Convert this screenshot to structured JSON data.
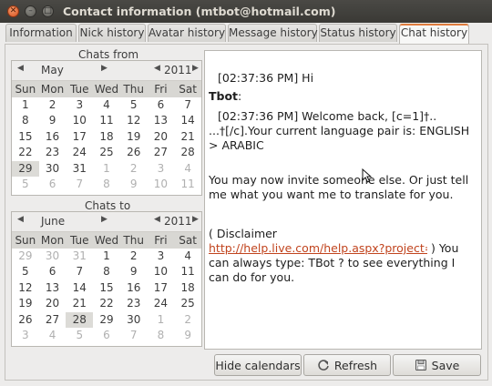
{
  "window": {
    "title": "Contact information (mtbot@hotmail.com)"
  },
  "tabs": [
    "Information",
    "Nick history",
    "Avatar history",
    "Message history",
    "Status history",
    "Chat history"
  ],
  "active_tab": "Chat history",
  "calendars": {
    "from": {
      "label": "Chats from",
      "month": "May",
      "year": "2011",
      "dow": [
        "Sun",
        "Mon",
        "Tue",
        "Wed",
        "Thu",
        "Fri",
        "Sat"
      ],
      "days": [
        [
          "1",
          "2",
          "3",
          "4",
          "5",
          "6",
          "7"
        ],
        [
          "8",
          "9",
          "10",
          "11",
          "12",
          "13",
          "14"
        ],
        [
          "15",
          "16",
          "17",
          "18",
          "19",
          "20",
          "21"
        ],
        [
          "22",
          "23",
          "24",
          "25",
          "26",
          "27",
          "28"
        ],
        [
          "29",
          "30",
          "31",
          "1",
          "2",
          "3",
          "4"
        ],
        [
          "5",
          "6",
          "7",
          "8",
          "9",
          "10",
          "11"
        ]
      ],
      "selected": "29"
    },
    "to": {
      "label": "Chats to",
      "month": "June",
      "year": "2011",
      "dow": [
        "Sun",
        "Mon",
        "Tue",
        "Wed",
        "Thu",
        "Fri",
        "Sat"
      ],
      "days": [
        [
          "29",
          "30",
          "31",
          "1",
          "2",
          "3",
          "4"
        ],
        [
          "5",
          "6",
          "7",
          "8",
          "9",
          "10",
          "11"
        ],
        [
          "12",
          "13",
          "14",
          "15",
          "16",
          "17",
          "18"
        ],
        [
          "19",
          "20",
          "21",
          "22",
          "23",
          "24",
          "25"
        ],
        [
          "26",
          "27",
          "28",
          "29",
          "30",
          "1",
          "2"
        ],
        [
          "3",
          "4",
          "5",
          "6",
          "7",
          "8",
          "9"
        ]
      ],
      "selected": "28"
    }
  },
  "chat": {
    "line1": "[02:37:36 PM] Hi",
    "sender": "Tbot",
    "sender_suffix": ":",
    "line2": "[02:37:36 PM] Welcome back, [c=1]†..          ...†[/c].Your current language pair is: ENGLISH > ARABIC",
    "line3": "You may now invite someone else. Or just tell me what you want me to translate for you.",
    "line4": "( Disclaimer",
    "link": "http://help.live.com/help.aspx?project=tou",
    "line5": ") You can always type: TBot ? to see everything I can do for you."
  },
  "buttons": {
    "hide": "Hide calendars",
    "refresh": "Refresh",
    "save": "Save"
  },
  "icons": {
    "refresh": "refresh-icon",
    "save": "save-icon"
  }
}
